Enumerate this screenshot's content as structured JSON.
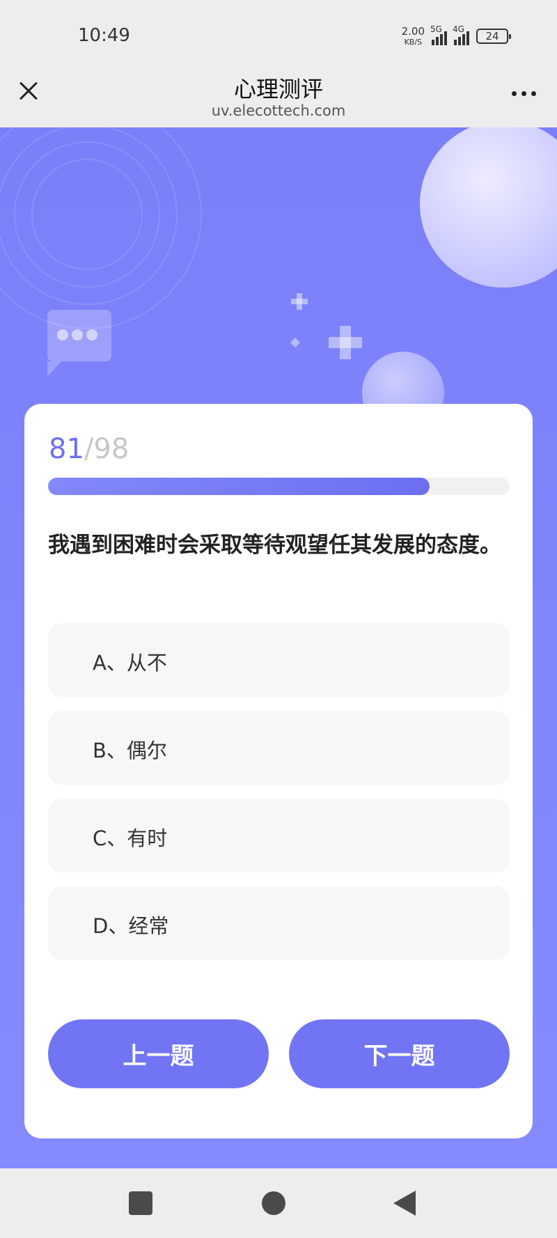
{
  "status_bar": {
    "time": "10:49",
    "net_speed": "2.00",
    "net_unit": "KB/S",
    "signal1_tag": "5G",
    "signal2_tag": "4G",
    "battery": "24"
  },
  "title_bar": {
    "title": "心理测评",
    "url": "uv.elecottech.com",
    "close_icon": "close-icon",
    "more_icon": "more-icon"
  },
  "progress": {
    "current": "81",
    "total": "/98",
    "fraction": 0.827
  },
  "question": {
    "text": "我遇到困难时会采取等待观望任其发展的态度。"
  },
  "options": [
    {
      "label": "A、从不"
    },
    {
      "label": "B、偶尔"
    },
    {
      "label": "C、有时"
    },
    {
      "label": "D、经常"
    }
  ],
  "buttons": {
    "prev": "上一题",
    "next": "下一题"
  },
  "colors": {
    "accent": "#7275f3",
    "background": "#7f84fb",
    "progress_current": "#6d70f0"
  }
}
